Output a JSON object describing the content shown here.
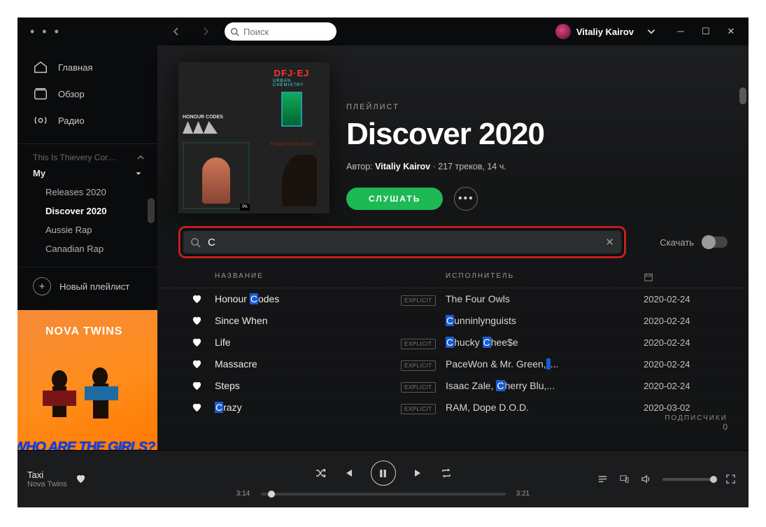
{
  "window": {
    "menu_glyph": "• • •"
  },
  "topbar": {
    "search_placeholder": "Поиск",
    "user_name": "Vitaliy Kairov"
  },
  "sidebar": {
    "nav": [
      {
        "id": "home",
        "label": "Главная",
        "icon": "home-icon"
      },
      {
        "id": "browse",
        "label": "Обзор",
        "icon": "browse-icon"
      },
      {
        "id": "radio",
        "label": "Радио",
        "icon": "radio-icon"
      }
    ],
    "truncated_top": "...",
    "folder": {
      "label": "My"
    },
    "playlists": [
      {
        "label": "Releases 2020",
        "active": false
      },
      {
        "label": "Discover 2020",
        "active": true
      },
      {
        "label": "Aussie Rap",
        "active": false
      },
      {
        "label": "Canadian Rap",
        "active": false
      }
    ],
    "new_playlist_label": "Новый плейлист",
    "art": {
      "band": "NOVA TWINS",
      "graffiti": "WHO ARE THE GIRLS?"
    }
  },
  "playlist": {
    "type_label": "ПЛЕЙЛИСТ",
    "title": "Discover 2020",
    "meta_author_prefix": "Автор: ",
    "meta_author": "Vitaliy Kairov",
    "meta_rest": " · 217 треков, 14 ч.",
    "play_label": "СЛУШАТЬ",
    "followers_label": "ПОДПИСЧИКИ",
    "followers_count": "0",
    "filter_value": "C",
    "download_label": "Скачать",
    "columns": {
      "title": "НАЗВАНИЕ",
      "artist": "ИСПОЛНИТЕЛЬ"
    },
    "tracks": [
      {
        "title_pre": "Honour ",
        "title_hl": "C",
        "title_post": "odes",
        "explicit": true,
        "artist_pre": "The Four Owls",
        "artist_hl": "",
        "artist_post": "",
        "date": "2020-02-24"
      },
      {
        "title_pre": "Since When",
        "title_hl": "",
        "title_post": "",
        "explicit": false,
        "artist_pre": "",
        "artist_hl": "C",
        "artist_post": "unninlynguists",
        "date": "2020-02-24"
      },
      {
        "title_pre": "Life",
        "title_hl": "",
        "title_post": "",
        "explicit": true,
        "artist_pre": "",
        "artist_hl": "C",
        "artist_post": "hucky ",
        "artist2_hl": "C",
        "artist2_post": "hee$e",
        "date": "2020-02-24"
      },
      {
        "title_pre": "Massacre",
        "title_hl": "",
        "title_post": "",
        "explicit": true,
        "artist_pre": "PaceWon & Mr. Green,",
        "artist_hl": " ",
        "artist_post": "...",
        "trail_hl": true,
        "date": "2020-02-24"
      },
      {
        "title_pre": "Steps",
        "title_hl": "",
        "title_post": "",
        "explicit": true,
        "artist_pre": "Isaac Zale, ",
        "artist_hl": "C",
        "artist_post": "herry Blu,...",
        "date": "2020-02-24"
      },
      {
        "title_pre": "",
        "title_hl": "C",
        "title_post": "razy",
        "explicit": true,
        "artist_pre": "RAM, Dope D.O.D.",
        "artist_hl": "",
        "artist_post": "",
        "date": "2020-03-02"
      }
    ],
    "explicit_badge": "EXPLICIT"
  },
  "player": {
    "track": "Taxi",
    "artist": "Nova Twins",
    "elapsed": "3:14",
    "total": "3:21"
  }
}
